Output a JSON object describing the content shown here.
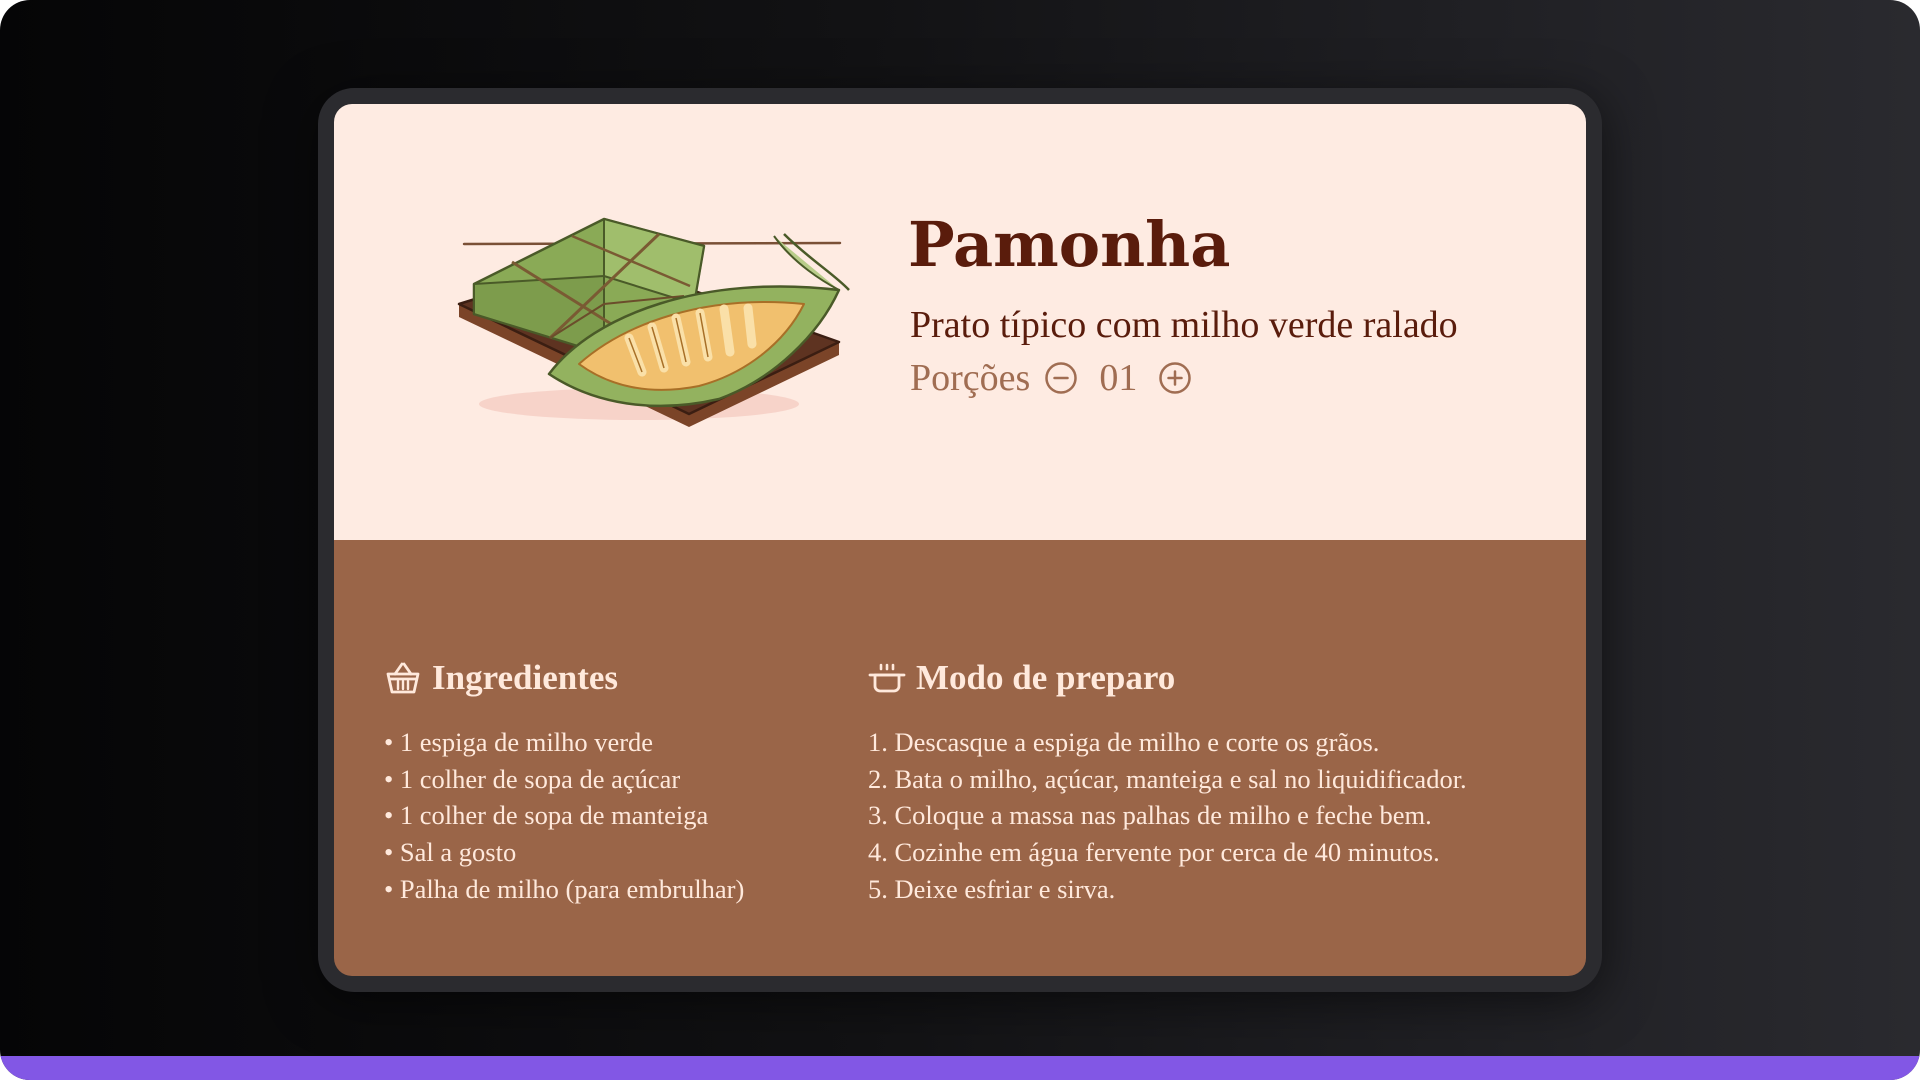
{
  "recipe": {
    "title": "Pamonha",
    "subtitle": "Prato típico com milho verde ralado",
    "servings": {
      "label": "Porções",
      "count": "01",
      "decrement_icon": "minus-circle-icon",
      "increment_icon": "plus-circle-icon"
    },
    "image": "pamonha-illustration"
  },
  "ingredients": {
    "heading": "Ingredientes",
    "icon": "basket-icon",
    "items": [
      "• 1 espiga de milho verde",
      "• 1 colher de sopa de açúcar",
      "• 1 colher de sopa de manteiga",
      "• Sal a gosto",
      "• Palha de milho (para embrulhar)"
    ]
  },
  "preparation": {
    "heading": "Modo de preparo",
    "icon": "cooking-pot-icon",
    "steps": [
      "1. Descasque a espiga de milho e corte os grãos.",
      "2. Bata o milho, açúcar, manteiga e sal no liquidificador.",
      "3. Coloque a massa nas palhas de milho e feche bem.",
      "4. Cozinhe em água fervente por cerca de 40 minutos.",
      "5. Deixe esfriar e sirva."
    ]
  },
  "colors": {
    "header_background": "#feebe2",
    "body_background": "#9a6548",
    "title_text": "#5a1c0c",
    "servings_text": "#a06d52",
    "body_text": "#ffe9dc",
    "accent_bar": "#8257e5"
  }
}
